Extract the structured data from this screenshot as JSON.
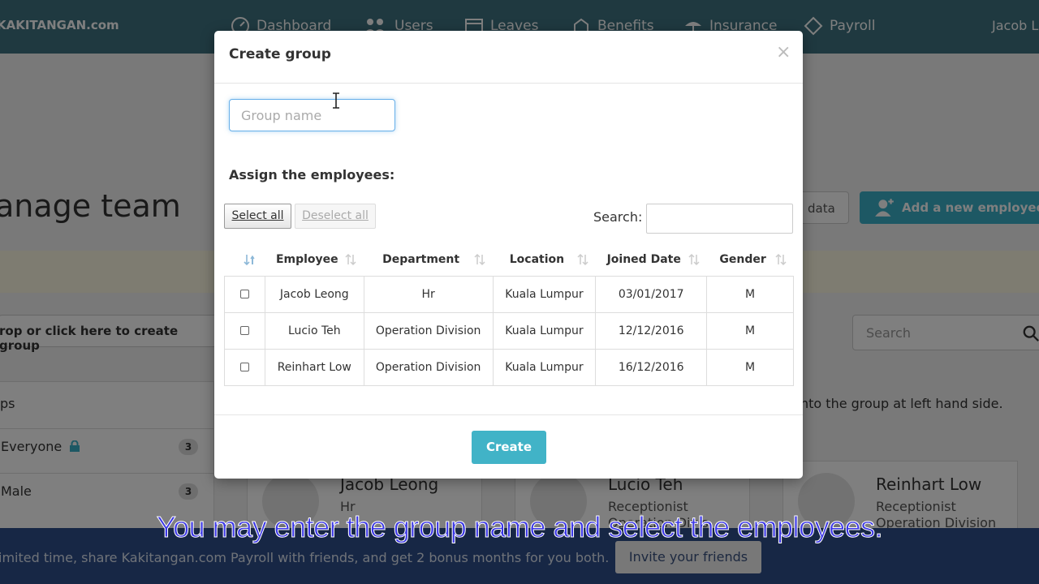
{
  "app": {
    "brand": "KAKITANGAN.com",
    "nav": [
      {
        "label": "Dashboard",
        "icon": "dashboard-icon"
      },
      {
        "label": "Users",
        "icon": "users-icon"
      },
      {
        "label": "Leaves",
        "icon": "calendar-icon"
      },
      {
        "label": "Benefits",
        "icon": "benefits-icon"
      },
      {
        "label": "Insurance",
        "icon": "insurance-icon"
      },
      {
        "label": "Payroll",
        "icon": "payroll-icon"
      }
    ],
    "user_name": "Jacob L",
    "page_title": "anage team",
    "import_data_label": "data",
    "add_employee_label": "Add a new employee",
    "drop_zone_label": "rop or click here to create group",
    "search_placeholder": "Search",
    "groups_header": "ps",
    "groups": [
      {
        "name": "Everyone",
        "count": "3",
        "locked": true
      },
      {
        "name": "Male",
        "count": "3",
        "locked": false
      }
    ],
    "hint_text": "nto the group at left hand side.",
    "employees": [
      {
        "name": "Jacob Leong",
        "role": "Hr",
        "division": ""
      },
      {
        "name": "Lucio Teh",
        "role": "Receptionist",
        "division": "Operation Divis"
      },
      {
        "name": "Reinhart Low",
        "role": "Receptionist",
        "division": "Operation Division"
      }
    ],
    "promo_text": "imited time, share Kakitangan.com Payroll with friends, and get 2 bonus months for you both.",
    "promo_button": "Invite your friends"
  },
  "modal": {
    "title": "Create group",
    "close_symbol": "×",
    "group_name_placeholder": "Group name",
    "assign_label": "Assign the employees:",
    "select_all_label": "Select all",
    "deselect_all_label": "Deselect all",
    "search_label": "Search:",
    "columns": [
      "Employee",
      "Department",
      "Location",
      "Joined Date",
      "Gender"
    ],
    "rows": [
      {
        "employee": "Jacob Leong",
        "department": "Hr",
        "location": "Kuala Lumpur",
        "joined": "03/01/2017",
        "gender": "M"
      },
      {
        "employee": "Lucio Teh",
        "department": "Operation Division",
        "location": "Kuala Lumpur",
        "joined": "12/12/2016",
        "gender": "M"
      },
      {
        "employee": "Reinhart Low",
        "department": "Operation Division",
        "location": "Kuala Lumpur",
        "joined": "16/12/2016",
        "gender": "M"
      }
    ],
    "create_label": "Create"
  },
  "caption": "You may enter the group name and select the employees.",
  "colors": {
    "topnav": "#3f7380",
    "accent": "#41b3c7",
    "promo": "#2f4e8a",
    "caption": "#3a36e6"
  }
}
